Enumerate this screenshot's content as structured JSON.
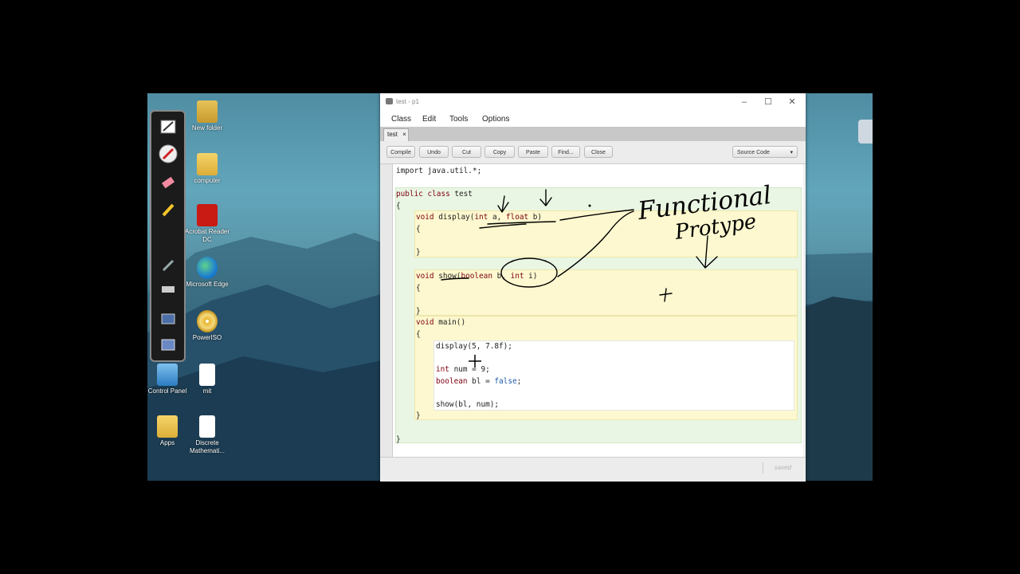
{
  "desktop": {
    "icons": [
      {
        "label": "New folder",
        "icon": "folder-icon"
      },
      {
        "label": "computer",
        "icon": "folder-icon"
      },
      {
        "label": "Acrobat Reader DC",
        "icon": "pdf-icon"
      },
      {
        "label": "Microsoft Edge",
        "icon": "edge-icon"
      },
      {
        "label": "PowerISO",
        "icon": "disc-icon"
      },
      {
        "label": "Control Panel",
        "icon": "control-panel-icon"
      },
      {
        "label": "mit",
        "icon": "file-icon"
      },
      {
        "label": "Apps",
        "icon": "apps-icon"
      },
      {
        "label": "Discrete Mathemati...",
        "icon": "file-icon"
      }
    ]
  },
  "pen_toolbar": {
    "tools": [
      "pen-icon",
      "laser-pointer-icon",
      "eraser-icon",
      "highlighter-icon",
      "brush-icon",
      "keyboard-icon",
      "screen-icon",
      "whiteboard-icon"
    ]
  },
  "window": {
    "title": "test - p1",
    "menu": [
      "Class",
      "Edit",
      "Tools",
      "Options"
    ],
    "tab": {
      "label": "test",
      "close": "×"
    },
    "toolbar": [
      "Compile",
      "Undo",
      "Cut",
      "Copy",
      "Paste",
      "Find...",
      "Close"
    ],
    "view_select": "Source Code",
    "status": "saved"
  },
  "code": {
    "l1": "import java.util.*;",
    "l2a": "public class",
    "l2b": " test",
    "l3": "{",
    "l4a": "void",
    "l4b": " display(",
    "l4c": "int",
    "l4d": " a, ",
    "l4e": "float",
    "l4f": " b)",
    "l5": "{",
    "l6": "}",
    "l7a": "void",
    "l7b": " show(",
    "l7c": "boolean",
    "l7d": " b, ",
    "l7e": "int",
    "l7f": " i)",
    "l8": "{",
    "l9": "}",
    "l10a": "void",
    "l10b": " main()",
    "l11": "{",
    "l12": "display(5, 7.8f);",
    "l13a": "int",
    "l13b": " num = 9;",
    "l14a": "boolean",
    "l14b": " bl = ",
    "l14c": "false",
    "l14d": ";",
    "l15": "show(bl, num);",
    "l16": "}",
    "l17": "}"
  },
  "annotation": {
    "line1": "Functional",
    "line2": "Protype"
  }
}
